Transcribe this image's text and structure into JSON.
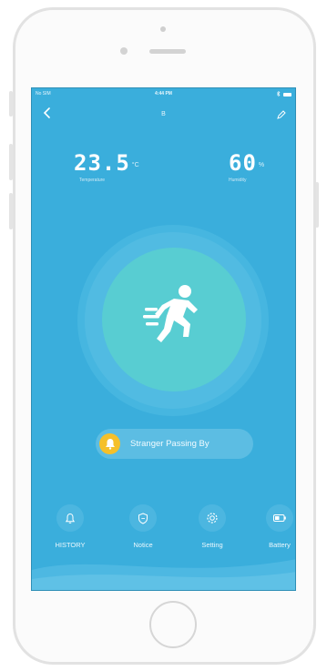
{
  "status_bar": {
    "carrier": "No SIM",
    "time": "4:44 PM"
  },
  "header": {
    "title": "B"
  },
  "readings": {
    "temperature": {
      "value": "23.5",
      "unit": "°C",
      "label": "Temperature"
    },
    "humidity": {
      "value": "60",
      "unit": "%",
      "label": "Humidity"
    }
  },
  "alert": {
    "text": "Stranger Passing By"
  },
  "bottom_nav": [
    {
      "label": "HISTORY",
      "icon": "bell-icon"
    },
    {
      "label": "Notice",
      "icon": "shield-icon"
    },
    {
      "label": "Setting",
      "icon": "gear-icon"
    },
    {
      "label": "Battery",
      "icon": "battery-icon"
    }
  ],
  "colors": {
    "screen_bg": "#3aaedc",
    "circle": "#58cdd2",
    "alert_badge": "#f5c02a"
  }
}
